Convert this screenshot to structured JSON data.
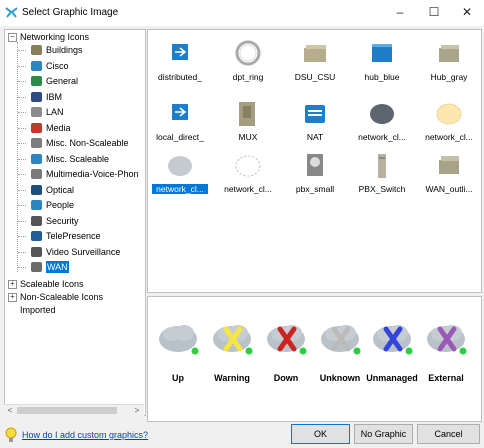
{
  "window": {
    "title": "Select Graphic Image",
    "minimize": "–",
    "maximize": "☐",
    "close": "✕"
  },
  "tree": {
    "root": "Networking Icons",
    "children": [
      "Buildings",
      "Cisco",
      "General",
      "IBM",
      "LAN",
      "Media",
      "Misc. Non-Scaleable",
      "Misc. Scaleable",
      "Multimedia-Voice-Phon",
      "Optical",
      "People",
      "Security",
      "TelePresence",
      "Video Surveillance",
      "WAN"
    ],
    "selected": "WAN",
    "other_roots": [
      "Scaleable Icons",
      "Non-Scaleable Icons",
      "Imported"
    ]
  },
  "gallery": {
    "items": [
      "distributed_",
      "dpt_ring",
      "DSU_CSU",
      "hub_blue",
      "Hub_gray",
      "local_direct_",
      "MUX",
      "NAT",
      "network_cl...",
      "network_cl...",
      "network_cl...",
      "network_cl...",
      "pbx_small",
      "PBX_Switch",
      "WAN_outli..."
    ],
    "selected_index": 10
  },
  "preview": {
    "states": [
      "Up",
      "Warning",
      "Down",
      "Unknown",
      "Unmanaged",
      "External"
    ],
    "colors": [
      "#2ecc40",
      "#f5e642",
      "#cc2222",
      "#bbbbbb",
      "#3344dd",
      "#9b59b6"
    ]
  },
  "footer": {
    "help_link": "How do I add custom graphics?",
    "ok": "OK",
    "no_graphic": "No Graphic",
    "cancel": "Cancel"
  }
}
